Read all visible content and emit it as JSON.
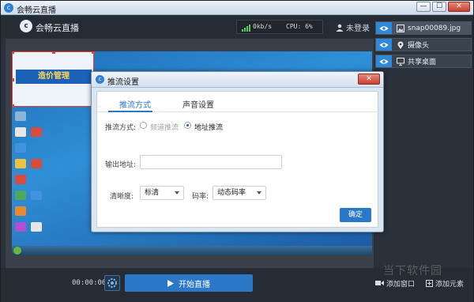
{
  "window": {
    "title": "会畅云直播",
    "controls": {
      "minimize": "—",
      "maximize": "☐",
      "close": "✕"
    }
  },
  "header": {
    "brand": "会畅云直播",
    "network": {
      "speed": "0kb/s",
      "cpu": "CPU: 6%"
    },
    "login": "未登录"
  },
  "sources": [
    {
      "label": "snap00089.jpg",
      "icon": "image-icon",
      "selected": true
    },
    {
      "label": "摄像头",
      "icon": "camera-pin-icon",
      "selected": false
    },
    {
      "label": "共享桌面",
      "icon": "monitor-icon",
      "selected": false
    }
  ],
  "preview": {
    "snapshot_title": "造价管理"
  },
  "footer": {
    "timer": "00:00:00",
    "start_label": "开始直播",
    "add_window": "添加窗口",
    "add_element": "添加元素",
    "watermark": "当下软件园"
  },
  "dialog": {
    "title": "推流设置",
    "close": "✕",
    "tabs": [
      {
        "label": "推流方式",
        "active": true
      },
      {
        "label": "声音设置",
        "active": false
      }
    ],
    "mode": {
      "label": "推流方式:",
      "options": [
        {
          "label": "频道推流",
          "checked": false,
          "disabled": true
        },
        {
          "label": "地址推流",
          "checked": true,
          "disabled": false
        }
      ]
    },
    "output": {
      "label": "输出地址:",
      "value": ""
    },
    "resolution": {
      "label": "清晰度:",
      "value": "标清"
    },
    "bitrate": {
      "label": "码率:",
      "value": "动态码率"
    },
    "confirm": "确定"
  },
  "colors": {
    "accent": "#2b78c9",
    "panel": "#262c33",
    "signal": "#5ccb53"
  }
}
